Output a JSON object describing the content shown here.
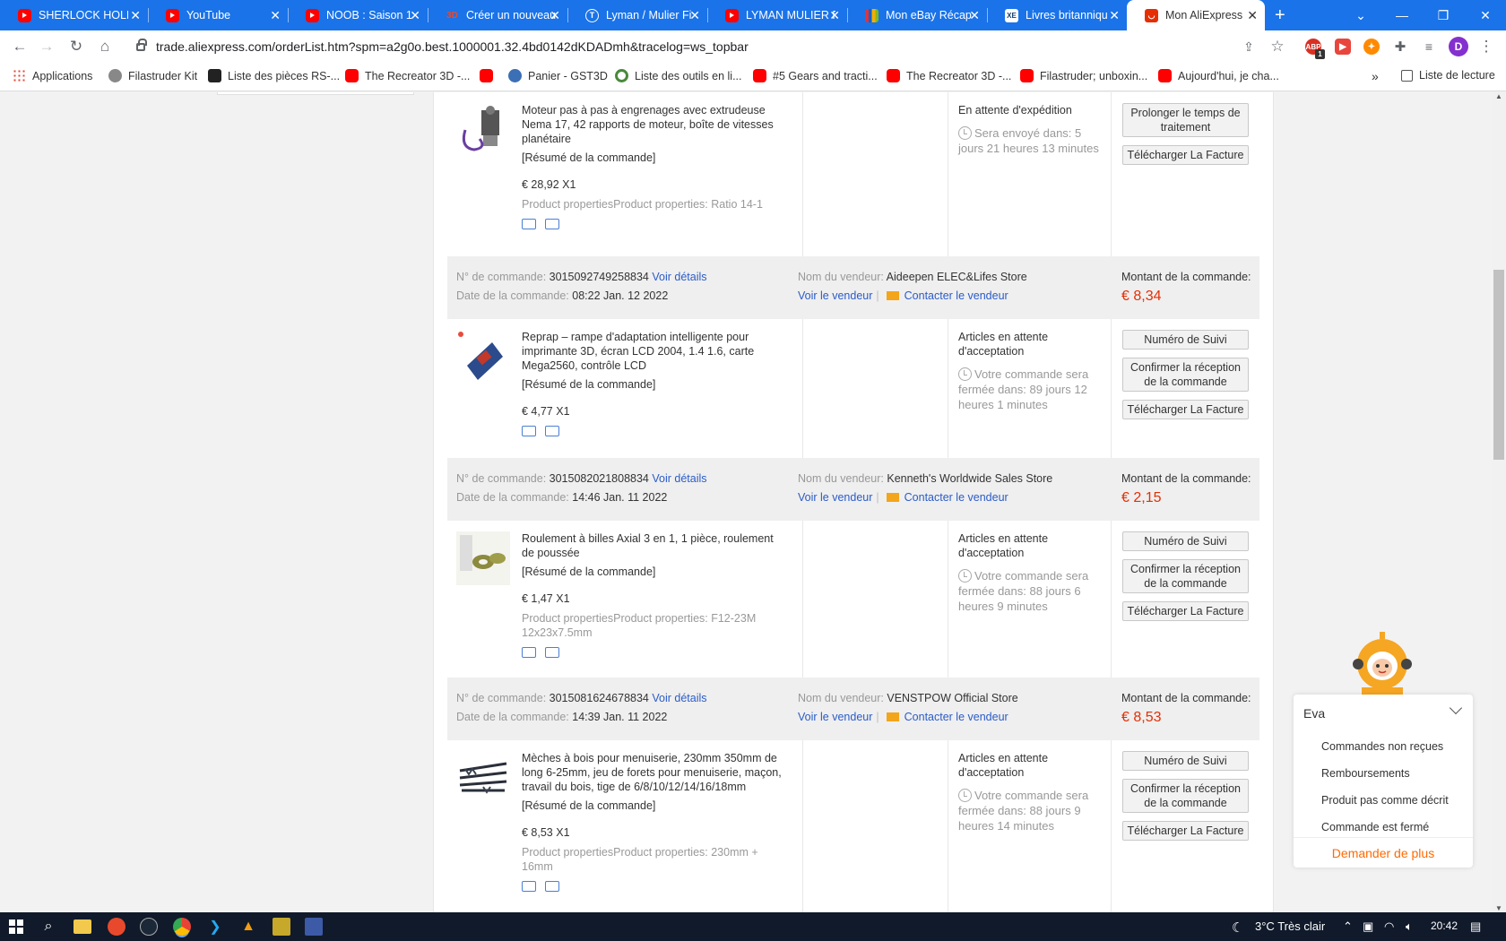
{
  "browser": {
    "tabs": [
      {
        "title": "SHERLOCK HOLMES",
        "icon": "youtube-icon",
        "active": false
      },
      {
        "title": "YouTube",
        "icon": "youtube-icon",
        "active": false
      },
      {
        "title": "NOOB : Saison 1",
        "icon": "youtube-icon",
        "active": false
      },
      {
        "title": "Créer un nouveau",
        "icon": "3d-icon",
        "active": false
      },
      {
        "title": "Lyman / Mulier Fi",
        "icon": "globe-icon",
        "active": false
      },
      {
        "title": "LYMAN MULIER F",
        "icon": "youtube-icon",
        "active": false
      },
      {
        "title": "Mon eBay Récap",
        "icon": "ebay-icon",
        "active": false
      },
      {
        "title": "Livres britanniqu",
        "icon": "xe-icon",
        "active": false
      },
      {
        "title": "Mon AliExpress",
        "icon": "aliexpress-icon",
        "active": true
      }
    ],
    "url": "trade.aliexpress.com/orderList.htm?spm=a2g0o.best.1000001.32.4bd0142dKDADmh&tracelog=ws_topbar",
    "profile_initial": "D",
    "extension_badge": "1",
    "bookmarks": [
      {
        "label": "Applications",
        "icon": "apps-grid-icon"
      },
      {
        "label": "Filastruder Kit",
        "icon": "filastruder-icon"
      },
      {
        "label": "Liste des pièces RS-...",
        "icon": "image-icon"
      },
      {
        "label": "The Recreator 3D -...",
        "icon": "youtube-icon"
      },
      {
        "label": "",
        "icon": "youtube-icon"
      },
      {
        "label": "Panier - GST3D",
        "icon": "globe-icon"
      },
      {
        "label": "Liste des outils en li...",
        "icon": "ring-icon"
      },
      {
        "label": "#5 Gears and tracti...",
        "icon": "youtube-icon"
      },
      {
        "label": "The Recreator 3D -...",
        "icon": "youtube-icon"
      },
      {
        "label": "Filastruder; unboxin...",
        "icon": "youtube-icon"
      },
      {
        "label": "Aujourd'hui, je cha...",
        "icon": "youtube-icon"
      }
    ],
    "overflow": "»",
    "reading_list": "Liste de lecture"
  },
  "labels": {
    "order_no": "N° de commande: ",
    "order_date": "Date de la commande: ",
    "seller_name": "Nom du vendeur: ",
    "order_amount": "Montant de la commande:",
    "view_details": "Voir détails",
    "view_seller": "Voir le vendeur",
    "contact_seller": "Contacter le vendeur",
    "summary": "[Résumé de la commande]",
    "btn_extend": "Prolonger le temps de traitement",
    "btn_tracking": "Numéro de Suivi",
    "btn_confirm": "Confirmer la réception de la commande",
    "btn_invoice": "Télécharger La Facture"
  },
  "orders": [
    {
      "product": "Moteur pas à pas à engrenages avec extrudeuse Nema 17, 42 rapports de moteur, boîte de vitesses planétaire",
      "price": "€ 28,92 X1",
      "props": "Product propertiesProduct properties: Ratio 14-1",
      "status": "En attente d'expédition",
      "timer": "Sera envoyé dans: 5 jours 21 heures 13 minutes"
    },
    {
      "number": "3015092749258834",
      "date": "08:22 Jan. 12 2022",
      "seller": "Aideepen ELEC&Lifes Store",
      "amount": "€ 8,34",
      "product": "Reprap – rampe d'adaptation intelligente pour imprimante 3D, écran LCD 2004, 1.4 1.6, carte Mega2560, contrôle LCD",
      "price": "€ 4,77 X1",
      "props": "",
      "status": "Articles en attente d'acceptation",
      "timer": "Votre commande sera fermée dans: 89 jours 12 heures 1 minutes"
    },
    {
      "number": "3015082021808834",
      "date": "14:46 Jan. 11 2022",
      "seller": "Kenneth's Worldwide Sales Store",
      "amount": "€ 2,15",
      "product": "Roulement à billes Axial 3 en 1, 1 pièce, roulement de poussée",
      "price": "€ 1,47 X1",
      "props": "Product propertiesProduct properties: F12-23M 12x23x7.5mm",
      "status": "Articles en attente d'acceptation",
      "timer": "Votre commande sera fermée dans: 88 jours 6 heures 9 minutes"
    },
    {
      "number": "3015081624678834",
      "date": "14:39 Jan. 11 2022",
      "seller": "VENSTPOW Official Store",
      "amount": "€ 8,53",
      "product": "Mèches à bois pour menuiserie, 230mm 350mm de long 6-25mm, jeu de forets pour menuiserie, maçon, travail du bois, tige de 6/8/10/12/14/16/18mm",
      "price": "€ 8,53 X1",
      "props": "Product propertiesProduct properties: 230mm + 16mm",
      "status": "Articles en attente d'acceptation",
      "timer": "Votre commande sera fermée dans: 88 jours 9 heures 14 minutes"
    }
  ],
  "chat": {
    "title": "Eva",
    "items": [
      "Commandes non reçues",
      "Remboursements",
      "Produit pas comme décrit",
      "Commande est fermé"
    ],
    "more": "Demander de plus"
  },
  "taskbar": {
    "weather": "3°C  Très clair",
    "time": "20:42"
  },
  "colors": {
    "chrome_blue": "#1a73e8",
    "price_red": "#e52e04",
    "link_blue": "#2b5cc8",
    "accent_orange": "#ff6a00"
  }
}
